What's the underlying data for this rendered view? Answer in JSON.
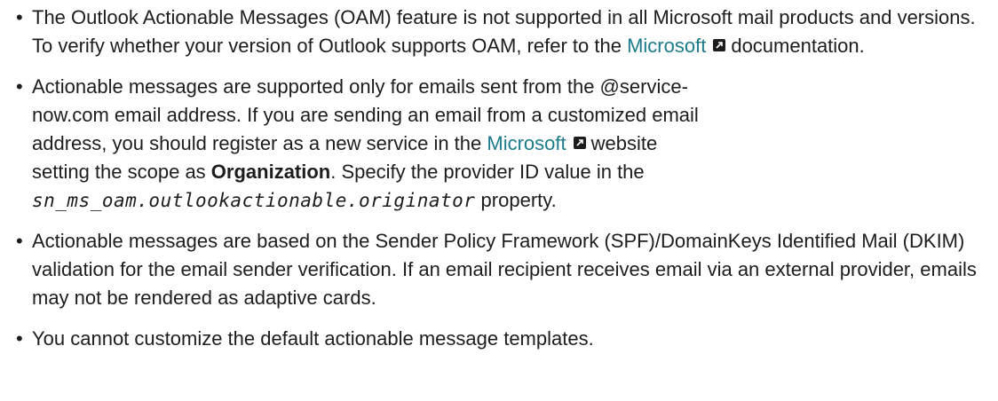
{
  "notes": {
    "item1": {
      "text_a": "The Outlook Actionable Messages (OAM) feature is not supported in all Microsoft mail products and versions. To verify whether your version of Outlook supports OAM, refer to the ",
      "link": "Microsoft",
      "text_b": "documentation."
    },
    "item2": {
      "line1": "Actionable messages are supported only for emails sent from the @service-",
      "line2": "now.com email address. If you are sending an email from a customized email",
      "line3_a": "address, you should register as a new service in the ",
      "link": "Microsoft",
      "line3_b": "website",
      "line4_a": "setting the scope as ",
      "bold": "Organization",
      "line4_b": ". Specify the provider ID value in the",
      "code": "sn_ms_oam.outlookactionable.originator",
      "line5_b": " property."
    },
    "item3": {
      "text": "Actionable messages are based on the Sender Policy Framework (SPF)/DomainKeys Identified Mail (DKIM) validation for the email sender verification. If an email recipient receives email via an external provider, emails may not be rendered as adaptive cards."
    },
    "item4": {
      "text": "You cannot customize the default actionable message templates."
    }
  },
  "icons": {
    "external_link": "external-link-icon"
  },
  "colors": {
    "link": "#1c7c8c",
    "text": "#1d1d1d"
  }
}
